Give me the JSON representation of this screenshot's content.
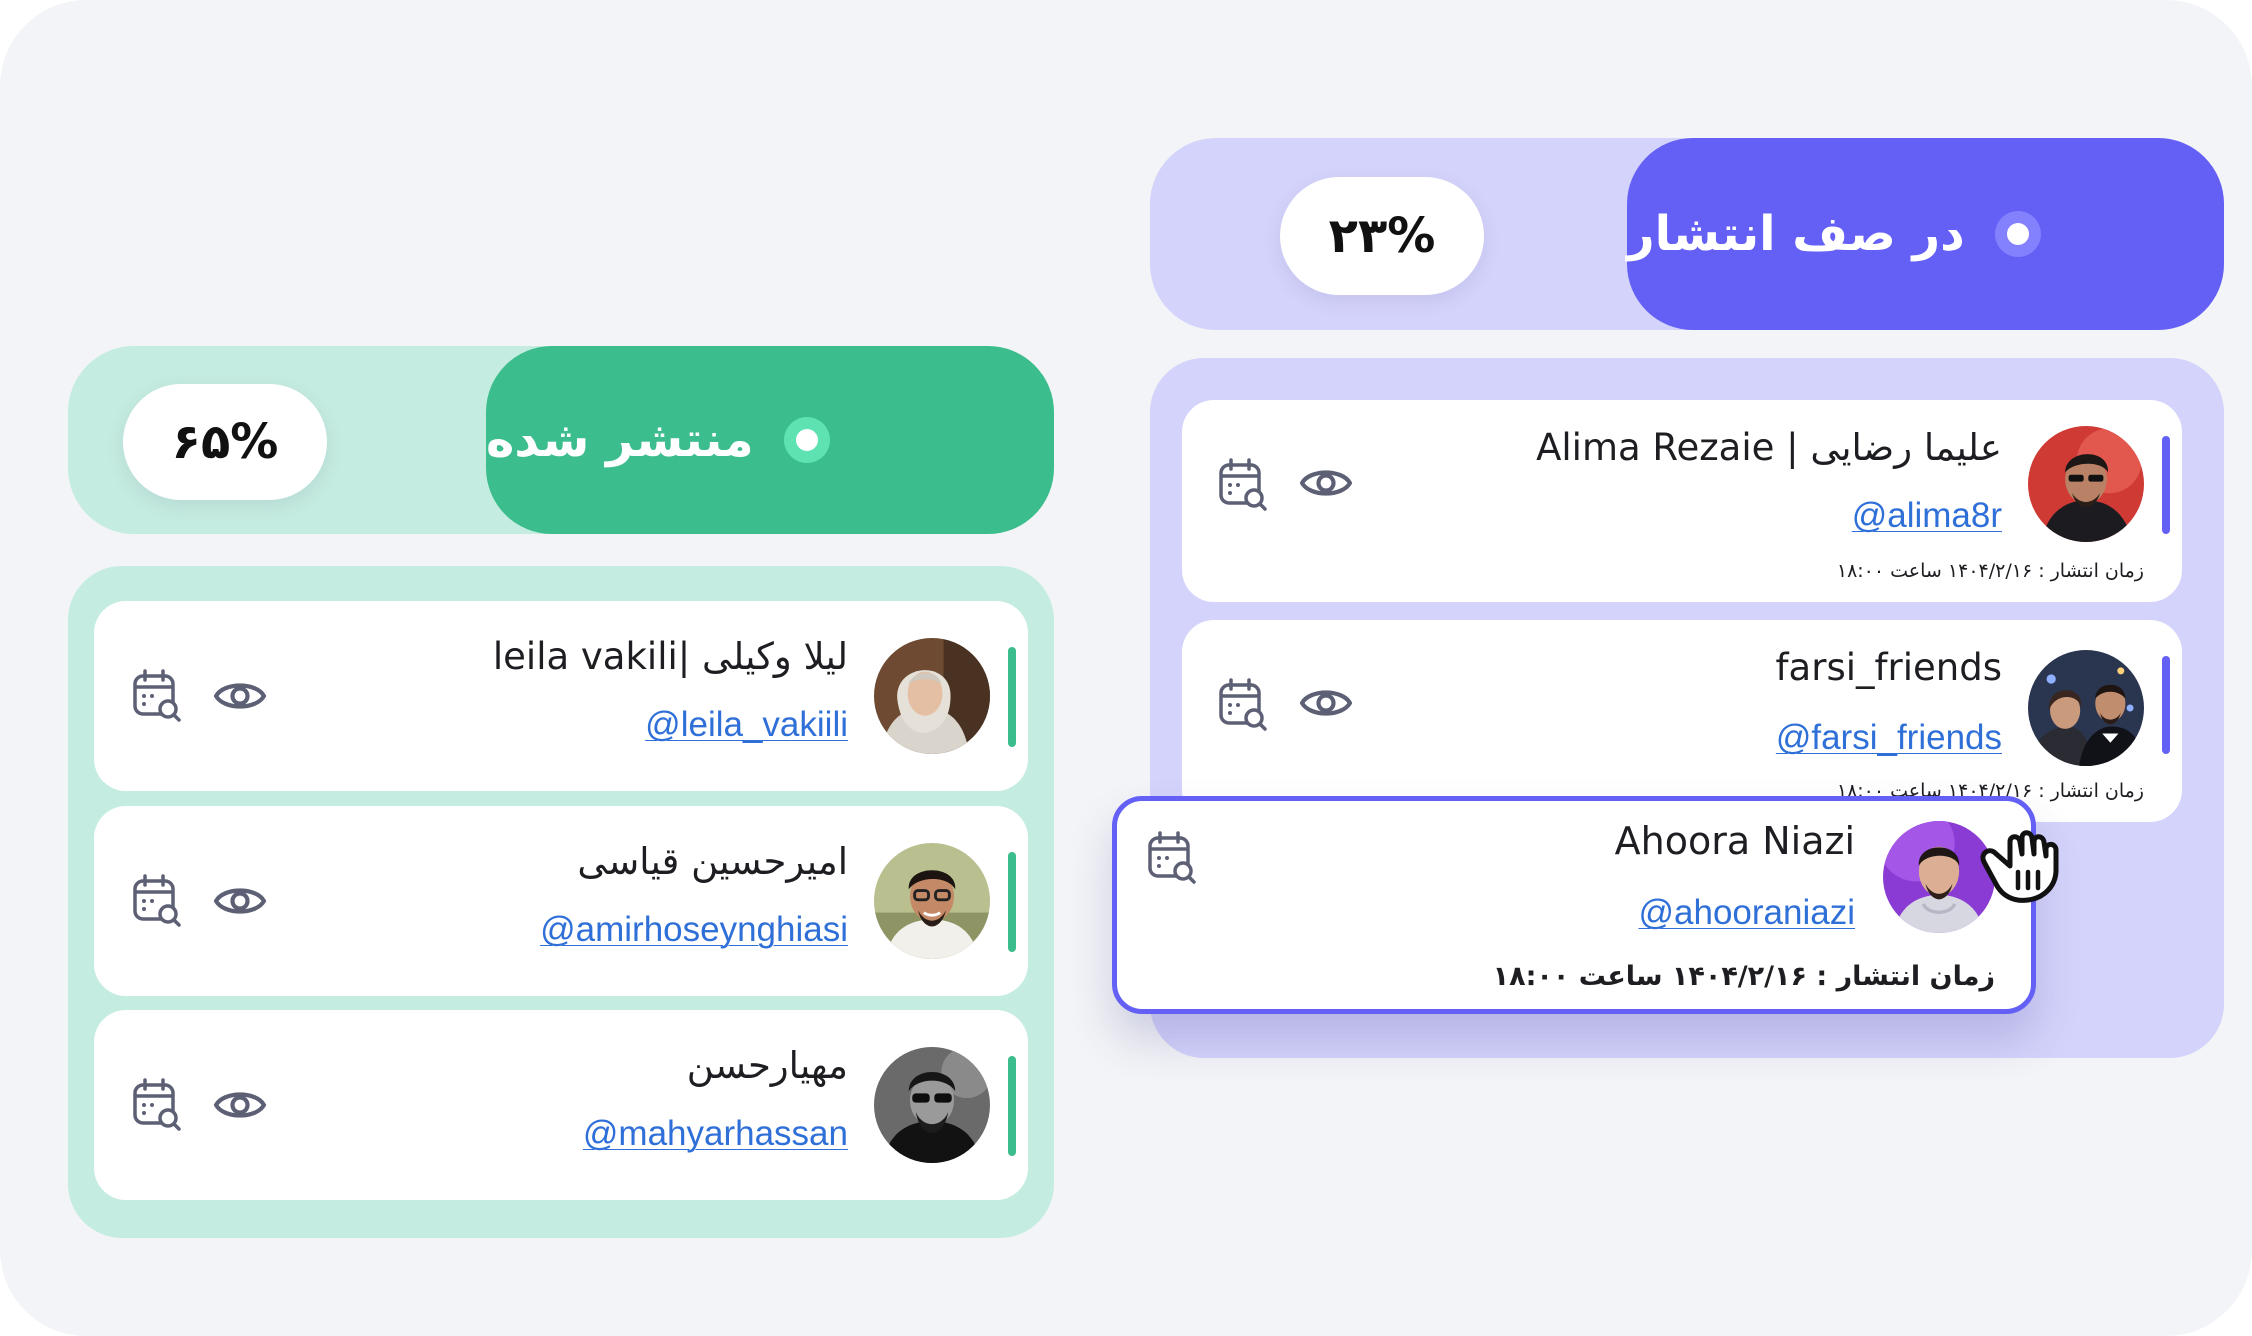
{
  "colors": {
    "background": "#f3f4f7",
    "green_accent": "#3cbd8d",
    "green_panel": "#c5ece0",
    "purple_accent": "#6460f6",
    "purple_panel": "#d4d3fb",
    "handle_link": "#2f6fd8"
  },
  "published_column": {
    "title": "منتشر شده",
    "percent": "۶۵%",
    "items": [
      {
        "name": "leila vakili| لیلا وکیلی",
        "handle": "@leila_vakiili",
        "icons": [
          "calendar-search-icon",
          "eye-icon"
        ]
      },
      {
        "name": "امیرحسین قیاسی",
        "handle": "@amirhoseynghiasi",
        "icons": [
          "calendar-search-icon",
          "eye-icon"
        ]
      },
      {
        "name": "مهیارحسن",
        "handle": "@mahyarhassan",
        "icons": [
          "calendar-search-icon",
          "eye-icon"
        ]
      }
    ]
  },
  "queue_column": {
    "title": "در صف انتشار",
    "percent": "۲۳%",
    "items": [
      {
        "name": "Alima Rezaie | علیما رضایی",
        "handle": "@alima8r",
        "schedule": "زمان انتشار : ۱۴۰۴/۲/۱۶  ساعت ۱۸:۰۰",
        "icons": [
          "calendar-search-icon",
          "eye-icon"
        ]
      },
      {
        "name": "farsi_friends",
        "handle": "@farsi_friends",
        "schedule": "زمان انتشار : ۱۴۰۴/۲/۱۶  ساعت ۱۸:۰۰",
        "icons": [
          "calendar-search-icon",
          "eye-icon"
        ]
      }
    ]
  },
  "dragged_card": {
    "name": "Ahoora Niazi",
    "handle": "@ahooraniazi",
    "schedule": "زمان انتشار : ۱۴۰۴/۲/۱۶  ساعت ۱۸:۰۰",
    "icons": [
      "calendar-search-icon"
    ],
    "cursor": "grab-hand-cursor-icon"
  }
}
